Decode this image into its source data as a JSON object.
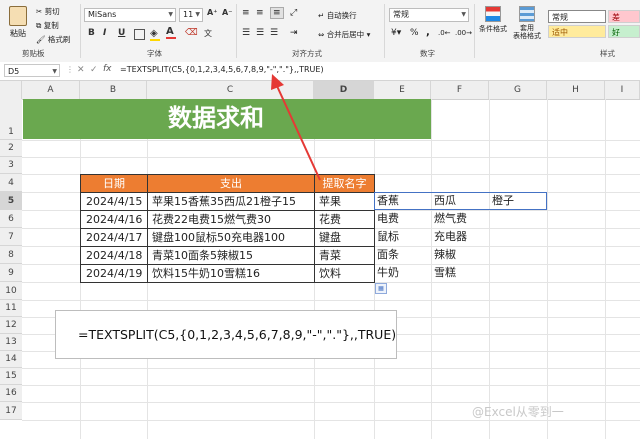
{
  "ribbon": {
    "clipboard": {
      "paste": "粘贴",
      "cut": "剪切",
      "copy": "复制",
      "format_painter": "格式刷",
      "group_label": "剪贴板"
    },
    "font": {
      "font_name": "MiSans",
      "font_size": "11",
      "group_label": "字体",
      "bold": "B",
      "italic": "I",
      "underline": "U",
      "grow": "A⁺",
      "shrink": "A⁻"
    },
    "alignment": {
      "wrap_text": "自动换行",
      "merge_center": "合并后居中",
      "group_label": "对齐方式"
    },
    "number": {
      "format": "常规",
      "percent": "%",
      "comma": ",",
      "group_label": "数字"
    },
    "styles": {
      "conditional_format": "条件格式",
      "table_format": "套用\n表格格式",
      "style_normal": "常规",
      "style_bad": "差",
      "style_neutral": "适中",
      "style_good": "好",
      "group_label": "样式"
    }
  },
  "formula_bar": {
    "name_box": "D5",
    "formula": "=TEXTSPLIT(C5,{0,1,2,3,4,5,6,7,8,9,\"-\",\".\"},,TRUE)",
    "cancel": "✕",
    "enter": "✓",
    "fx": "fx"
  },
  "columns": [
    "A",
    "B",
    "C",
    "D",
    "E",
    "F",
    "G",
    "H",
    "I"
  ],
  "rows": [
    "1",
    "2",
    "3",
    "4",
    "5",
    "6",
    "7",
    "8",
    "9",
    "10",
    "11",
    "12",
    "13",
    "14",
    "15",
    "16",
    "17"
  ],
  "sheet": {
    "title": "数据求和",
    "headers": [
      "日期",
      "支出",
      "提取名字"
    ],
    "table": [
      {
        "date": "2024/4/15",
        "expense": "苹果15香蕉35西瓜21橙子15",
        "name": "苹果"
      },
      {
        "date": "2024/4/16",
        "expense": "花费22电费15燃气费30",
        "name": "花费"
      },
      {
        "date": "2024/4/17",
        "expense": "键盘100鼠标50充电器100",
        "name": "键盘"
      },
      {
        "date": "2024/4/18",
        "expense": "青菜10面条5辣椒15",
        "name": "青菜"
      },
      {
        "date": "2024/4/19",
        "expense": "饮料15牛奶10雪糕16",
        "name": "饮料"
      }
    ],
    "spill": [
      [
        "香蕉",
        "西瓜",
        "橙子"
      ],
      [
        "电费",
        "燃气费",
        ""
      ],
      [
        "鼠标",
        "充电器",
        ""
      ],
      [
        "面条",
        "辣椒",
        ""
      ],
      [
        "牛奶",
        "雪糕",
        ""
      ]
    ],
    "formula_note": "=TEXTSPLIT(C5,{0,1,2,3,4,5,6,7,8,9,\"-\",\".\"},,TRUE)"
  },
  "watermark": "@Excel从零到一",
  "colors": {
    "title_bg": "#6aa84f",
    "header_bg": "#ed7d31",
    "arrow": "#e53935",
    "bad_bg": "#ffc7ce",
    "neutral_bg": "#ffeb9c",
    "good_bg": "#c6efce"
  }
}
